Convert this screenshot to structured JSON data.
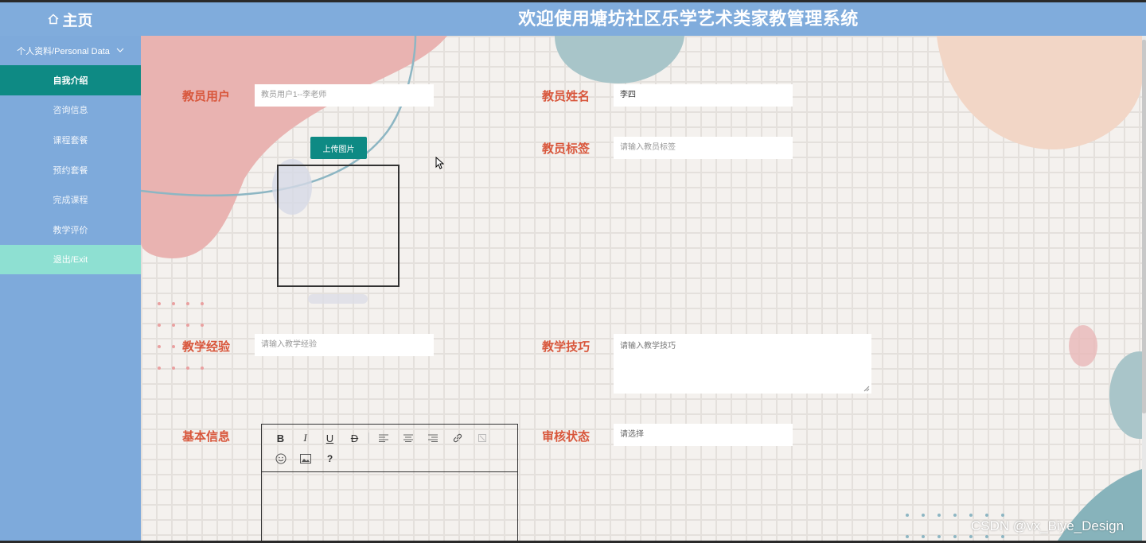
{
  "header": {
    "home_label": "主页",
    "system_title": "欢迎使用塘坊社区乐学艺术类家教管理系统"
  },
  "sidebar": {
    "group_label": "个人资料/Personal Data",
    "items": [
      {
        "label": "自我介绍",
        "active": true
      },
      {
        "label": "咨询信息"
      },
      {
        "label": "课程套餐"
      },
      {
        "label": "预约套餐"
      },
      {
        "label": "完成课程"
      },
      {
        "label": "教学评价"
      },
      {
        "label": "退出/Exit"
      }
    ]
  },
  "form": {
    "teacher_user": {
      "label": "教员用户",
      "value": "教员用户1--李老师"
    },
    "teacher_name": {
      "label": "教员姓名",
      "value": "李四"
    },
    "upload_button": "上传图片",
    "teacher_tag": {
      "label": "教员标签",
      "placeholder": "请输入教员标签"
    },
    "teaching_exp": {
      "label": "教学经验",
      "placeholder": "请输入教学经验"
    },
    "teaching_skill": {
      "label": "教学技巧",
      "placeholder": "请输入教学技巧"
    },
    "basic_info": {
      "label": "基本信息"
    },
    "review_status": {
      "label": "审核状态",
      "placeholder": "请选择"
    }
  },
  "editor": {
    "tools": [
      "B",
      "I",
      "U",
      "D",
      "align-left",
      "align-center",
      "align-right",
      "link",
      "unlink",
      "emoji",
      "image",
      "?"
    ]
  },
  "watermark": "CSDN @vx_Biye_Design",
  "colors": {
    "topbar": "#80acdc",
    "sidebar": "#7eaadb",
    "active_item": "#0e8a84",
    "exit_item": "#8ee0d2",
    "label": "#d8563b"
  }
}
